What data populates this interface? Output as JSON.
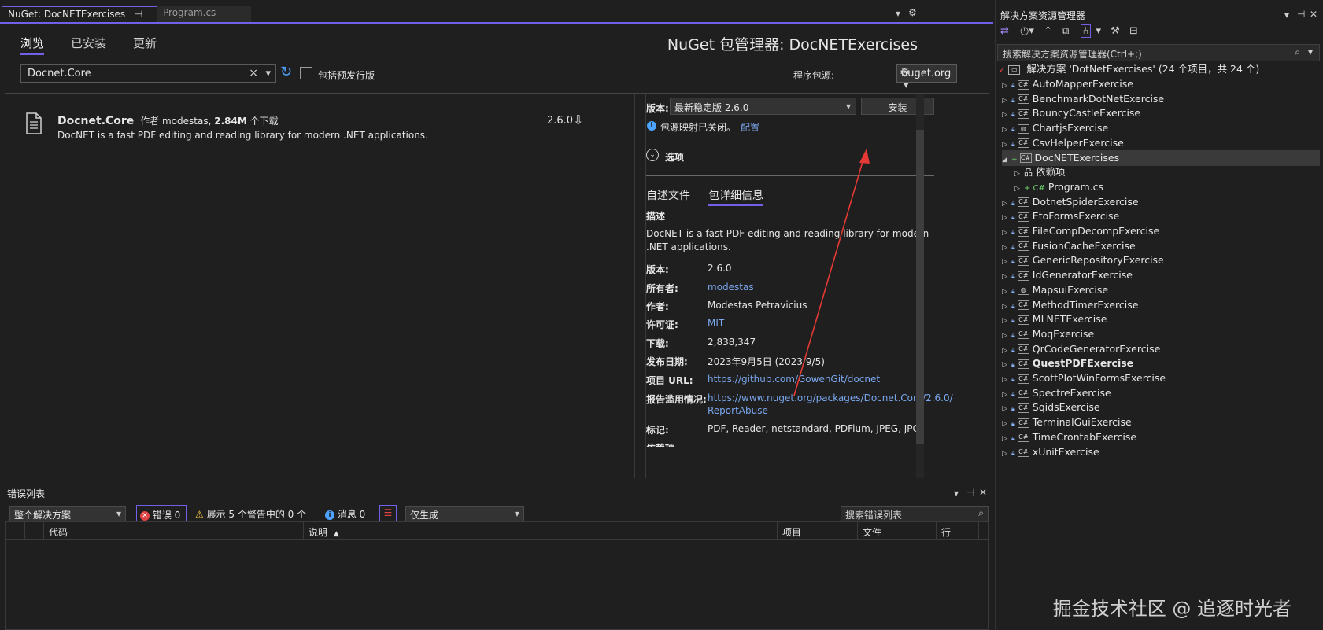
{
  "tabs": {
    "nuget": "NuGet: DocNETExercises",
    "nuget_pin": "⊣",
    "program": "Program.cs",
    "chevron": "▾",
    "gear": "⚙"
  },
  "nuget": {
    "tab_browse": "浏览",
    "tab_installed": "已安装",
    "tab_updates": "更新",
    "title": "NuGet 包管理器: DocNETExercises",
    "search_value": "Docnet.Core",
    "clear_glyph": "×",
    "dropdown_glyph": "▾",
    "refresh_glyph": "↻",
    "prerelease_label": "包括预发行版",
    "source_label": "程序包源:",
    "source_value": "nuget.org"
  },
  "package": {
    "name": "Docnet.Core",
    "by_label": "作者",
    "author": "modestas,",
    "downloads": "2.84M",
    "downloads_label": "个下载",
    "description": "DocNET is a fast PDF editing and reading library for modern .NET applications.",
    "version": "2.6.0",
    "download_glyph": "⇩"
  },
  "details": {
    "version_label": "版本:",
    "version_select": "最新稳定版 2.6.0",
    "install_button": "安装",
    "info_glyph": "i",
    "mapping_notice": "包源映射已关闭。",
    "configure_link": "配置",
    "options_label": "选项",
    "tab_readme": "自述文件",
    "tab_details": "包详细信息",
    "description_heading": "描述",
    "description_text": "DocNET is a fast PDF editing and reading library for modern .NET applications.",
    "fields": {
      "version_label": "版本:",
      "version_value": "2.6.0",
      "owners_label": "所有者:",
      "owners_value": "modestas",
      "authors_label": "作者:",
      "authors_value": "Modestas Petravicius",
      "license_label": "许可证:",
      "license_value": "MIT",
      "downloads_label": "下载:",
      "downloads_value": "2,838,347",
      "published_label": "发布日期:",
      "published_value": "2023年9月5日 (2023/9/5)",
      "project_url_label": "项目 URL:",
      "project_url_value": "https://github.com/GowenGit/docnet",
      "report_label": "报告滥用情况:",
      "report_value_1": "https://www.nuget.org/packages/Docnet.Core/2.6.0/",
      "report_value_2": "ReportAbuse",
      "tags_label": "标记:",
      "tags_value": "PDF, Reader, netstandard, PDFium, JPEG, JPG",
      "deps_label": "依赖项"
    }
  },
  "error_list": {
    "title": "错误列表",
    "scope": "整个解决方案",
    "errors_label": "错误 0",
    "warnings_label": "展示 5 个警告中的 0 个",
    "messages_label": "消息 0",
    "build_filter": "仅生成",
    "search_placeholder": "搜索错误列表",
    "col_code": "代码",
    "col_desc": "说明",
    "col_project": "项目",
    "col_file": "文件",
    "col_line": "行",
    "sort_glyph": "▲",
    "close_glyph": "✕",
    "pin_glyph": "⊣",
    "menu_glyph": "▾"
  },
  "solution": {
    "title": "解决方案资源管理器",
    "search_placeholder": "搜索解决方案资源管理器(Ctrl+;)",
    "root": "解决方案 'DotNetExercises' (24 个项目，共 24 个)",
    "projects": [
      "AutoMapperExercise",
      "BenchmarkDotNetExercise",
      "BouncyCastleExercise",
      "ChartjsExercise",
      "CsvHelperExercise",
      "DocNETExercises",
      "依赖项",
      "Program.cs",
      "DotnetSpiderExercise",
      "EtoFormsExercise",
      "FileCompDecompExercise",
      "FusionCacheExercise",
      "GenericRepositoryExercise",
      "IdGeneratorExercise",
      "MapsuiExercise",
      "MethodTimerExercise",
      "MLNETExercise",
      "MoqExercise",
      "QrCodeGeneratorExercise",
      "QuestPDFExercise",
      "ScottPlotWinFormsExercise",
      "SpectreExercise",
      "SqidsExercise",
      "TerminalGuiExercise",
      "TimeCrontabExercise",
      "xUnitExercise"
    ],
    "proj_icon": "C#"
  },
  "watermark": "掘金技术社区 @ 追逐时光者",
  "colors": {
    "accent": "#7160e8",
    "link": "#7aa7ee",
    "arrow": "#e53935",
    "error": "#e04444"
  }
}
